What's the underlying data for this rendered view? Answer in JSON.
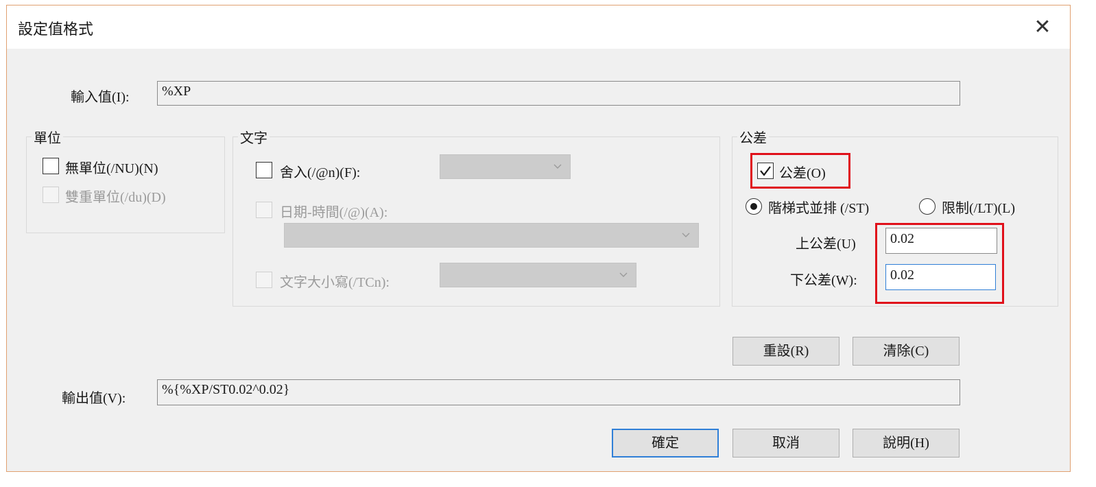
{
  "dialog": {
    "title": "設定值格式",
    "close_symbol": "✕"
  },
  "input": {
    "label": "輸入值(I):",
    "value": "%XP"
  },
  "units": {
    "title": "單位",
    "no_unit": {
      "label": "無單位(/NU)(N)",
      "checked": false,
      "enabled": true
    },
    "dual_unit": {
      "label": "雙重單位(/du)(D)",
      "checked": false,
      "enabled": false
    }
  },
  "text": {
    "title": "文字",
    "round": {
      "label": "舍入(/@n)(F):",
      "checked": false,
      "enabled": true,
      "selected": ""
    },
    "datetime": {
      "label": "日期-時間(/@)(A):",
      "checked": false,
      "enabled": false,
      "selected": ""
    },
    "case": {
      "label": "文字大小寫(/TCn):",
      "checked": false,
      "enabled": false,
      "selected": ""
    }
  },
  "tolerance": {
    "title": "公差",
    "enable": {
      "label": "公差(O)",
      "checked": true
    },
    "stacked": {
      "label": "階梯式並排 (/ST)",
      "selected": true
    },
    "limit": {
      "label": "限制(/LT)(L)",
      "selected": false
    },
    "upper": {
      "label": "上公差(U)",
      "value": "0.02"
    },
    "lower": {
      "label": "下公差(W):",
      "value": "0.02"
    }
  },
  "buttons": {
    "reset": "重設(R)",
    "clear": "清除(C)",
    "ok": "確定",
    "cancel": "取消",
    "help": "說明(H)"
  },
  "output": {
    "label": "輸出值(V):",
    "value": "%{%XP/ST0.02^0.02}"
  },
  "colors": {
    "highlight": "#e0101a",
    "focus": "#2f7fd7",
    "dialog_bg": "#f0f0f0"
  },
  "icons": {
    "close": "close-icon",
    "check": "checkmark-icon",
    "dropdown": "chevron-down-icon"
  }
}
